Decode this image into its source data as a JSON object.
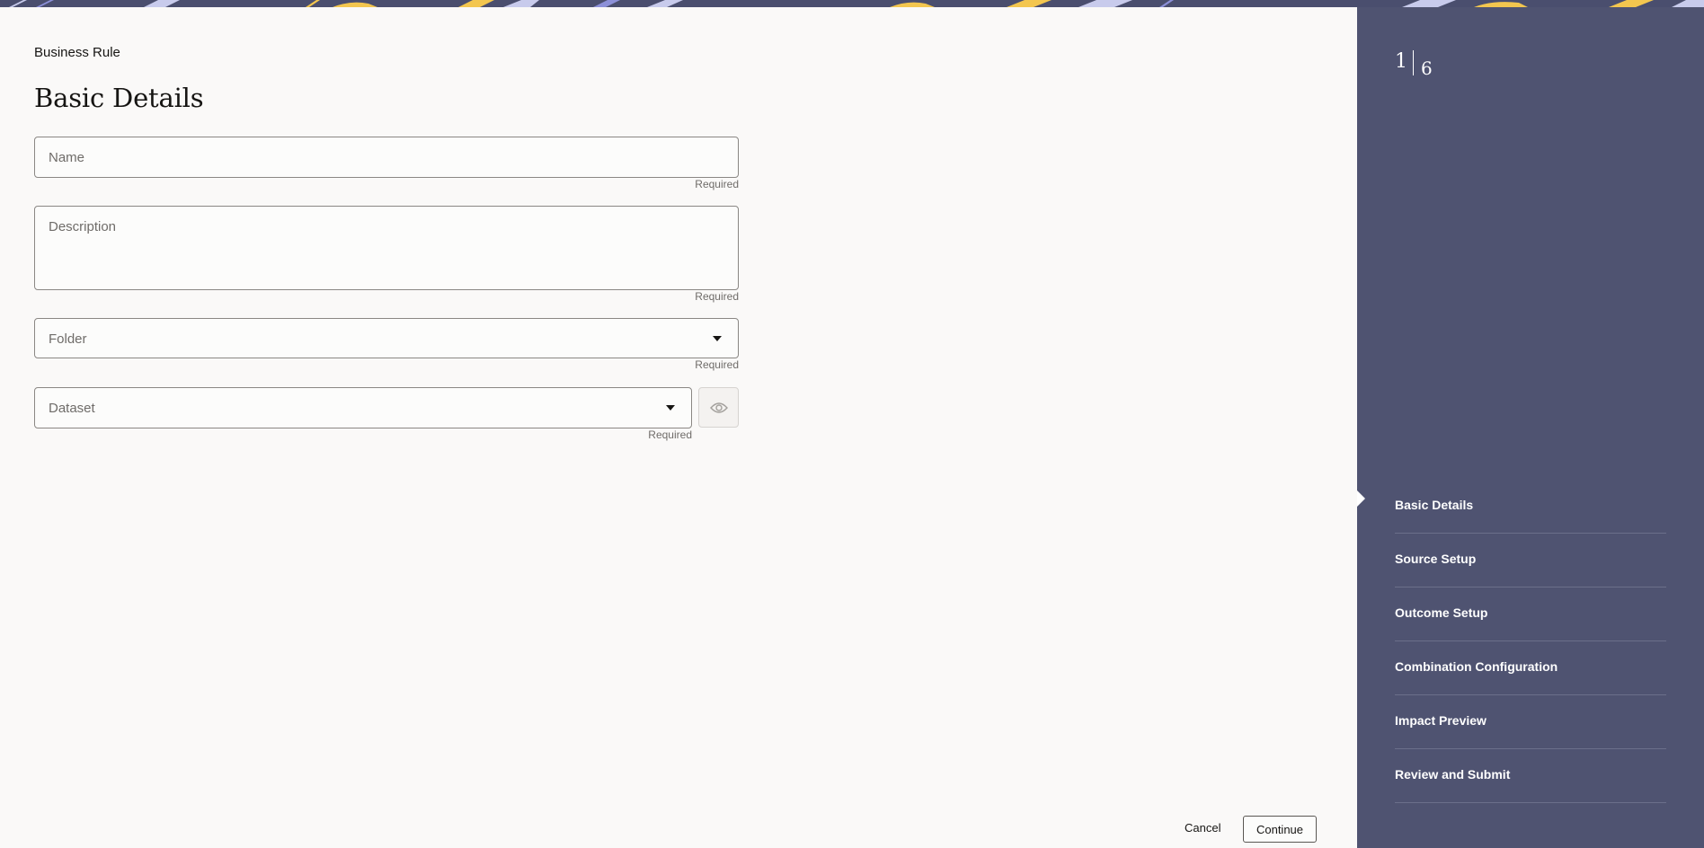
{
  "header": {
    "eyebrow": "Business Rule",
    "title": "Basic Details"
  },
  "form": {
    "name": {
      "placeholder": "Name",
      "helper": "Required"
    },
    "description": {
      "placeholder": "Description",
      "helper": "Required"
    },
    "folder": {
      "placeholder": "Folder",
      "helper": "Required"
    },
    "dataset": {
      "placeholder": "Dataset",
      "helper": "Required"
    }
  },
  "footer": {
    "cancel_label": "Cancel",
    "continue_label": "Continue"
  },
  "train": {
    "current": "1",
    "total": "6",
    "steps": [
      {
        "label": "Basic Details",
        "active": true
      },
      {
        "label": "Source Setup",
        "active": false
      },
      {
        "label": "Outcome Setup",
        "active": false
      },
      {
        "label": "Combination Configuration",
        "active": false
      },
      {
        "label": "Impact Preview",
        "active": false
      },
      {
        "label": "Review and Submit",
        "active": false
      }
    ]
  },
  "icons": {
    "dataset_preview": "eye-icon",
    "folder_dropdown": "chevron-down-icon",
    "dataset_dropdown": "chevron-down-icon"
  },
  "colors": {
    "rail_background": "#4f5371",
    "page_background": "#faf9f8",
    "banner_yellow": "#f3c64f",
    "banner_lavender": "#c8cbec"
  }
}
